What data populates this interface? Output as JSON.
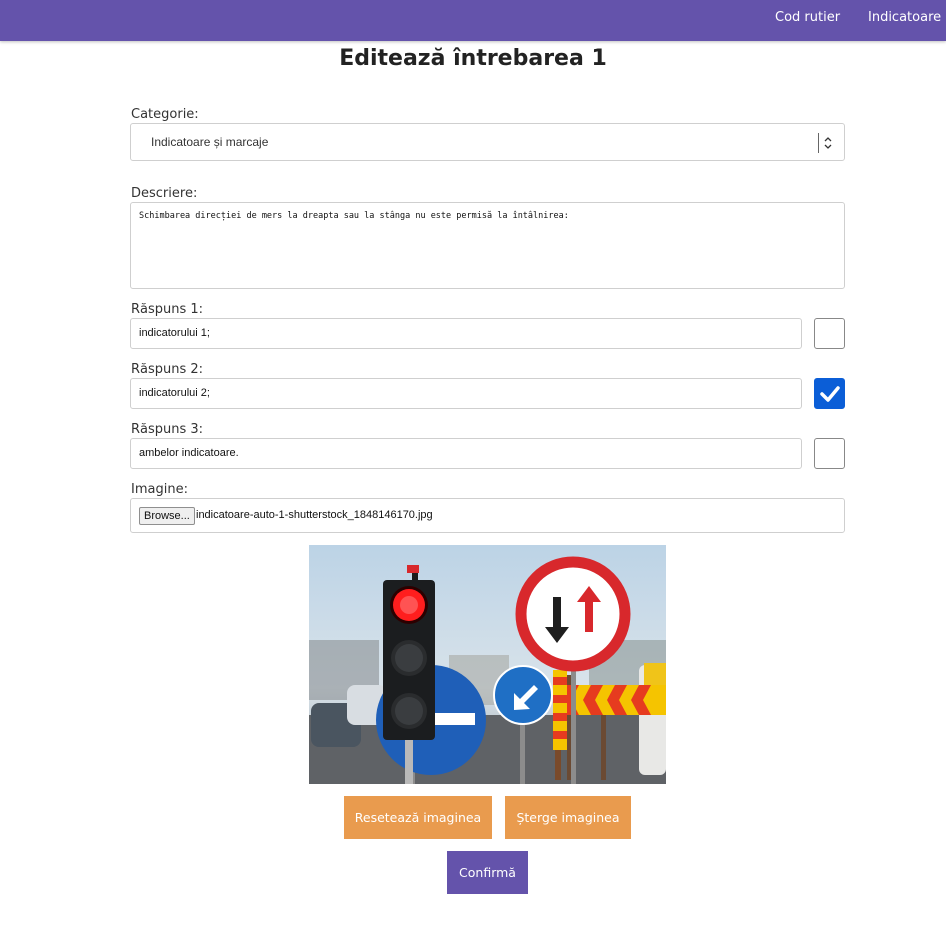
{
  "nav": {
    "links": [
      "Cod rutier",
      "Indicatoare"
    ]
  },
  "page": {
    "title": "Editează întrebarea 1"
  },
  "form": {
    "category": {
      "label": "Categorie:",
      "selected": "Indicatoare și marcaje"
    },
    "description": {
      "label": "Descriere:",
      "value": "Schimbarea direcției de mers la dreapta sau la stânga nu este permisă la întâlnirea:"
    },
    "answers": [
      {
        "label": "Răspuns 1:",
        "value": "indicatorului 1;",
        "correct": false
      },
      {
        "label": "Răspuns 2:",
        "value": "indicatorului 2;",
        "correct": true
      },
      {
        "label": "Răspuns 3:",
        "value": "ambelor indicatoare.",
        "correct": false
      }
    ],
    "image": {
      "label": "Imagine:",
      "browse_label": "Browse...",
      "file_name": "indicatoare-auto-1-shutterstock_1848146170.jpg"
    }
  },
  "actions": {
    "reset_image": "Resetează imaginea",
    "delete_image": "Șterge imaginea",
    "confirm": "Confirmă"
  },
  "colors": {
    "brand": "#6453ab",
    "accent_orange": "#e99b4e",
    "checkbox_checked": "#0b5ed7"
  }
}
